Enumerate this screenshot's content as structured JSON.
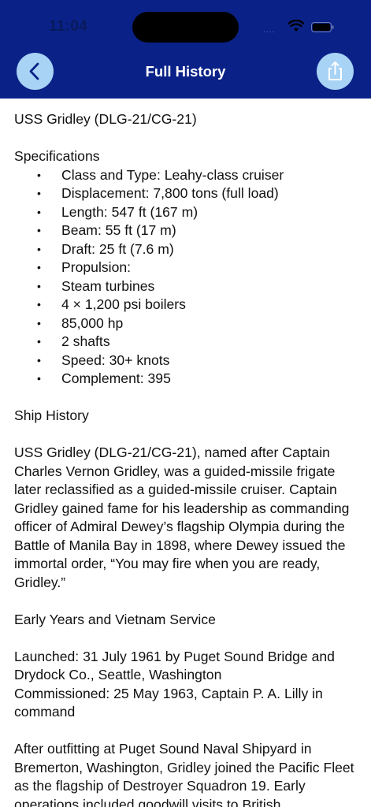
{
  "status_bar": {
    "time": "11:04",
    "signal": "....",
    "wifi_icon": "wifi-icon",
    "battery_icon": "battery-icon"
  },
  "nav": {
    "title": "Full History",
    "back_icon": "chevron-left-icon",
    "share_icon": "share-icon",
    "bar_color": "#0a2287",
    "button_color": "#a8d3f5"
  },
  "article": {
    "heading": "USS Gridley (DLG-21/CG-21)",
    "specs_heading": "Specifications",
    "specs": [
      "Class and Type: Leahy-class cruiser",
      "Displacement: 7,800 tons (full load)",
      "Length: 547 ft (167 m)",
      "Beam: 55 ft (17 m)",
      "Draft: 25 ft (7.6 m)",
      "Propulsion:",
      "Steam turbines",
      "4 × 1,200 psi boilers",
      "85,000 hp",
      "2 shafts",
      "Speed: 30+ knots",
      "Complement: 395"
    ],
    "history_heading": "Ship History",
    "history_paragraph": "USS Gridley (DLG-21/CG-21), named after Captain Charles Vernon Gridley, was a guided-missile frigate later reclassified as a guided-missile cruiser. Captain Gridley gained fame for his leadership as commanding officer of Admiral Dewey’s flagship Olympia during the Battle of Manila Bay in 1898, where Dewey issued the immortal order, “You may fire when you are ready, Gridley.”",
    "early_heading": "Early Years and Vietnam Service",
    "launched": "Launched: 31 July 1961 by Puget Sound Bridge and Drydock Co., Seattle, Washington",
    "commissioned": "Commissioned: 25 May 1963, Captain P. A. Lilly in command",
    "outfitting_paragraph": "After outfitting at Puget Sound Naval Shipyard in Bremerton, Washington, Gridley joined the Pacific Fleet as the flagship of Destroyer Squadron 19. Early operations included goodwill visits to British"
  }
}
